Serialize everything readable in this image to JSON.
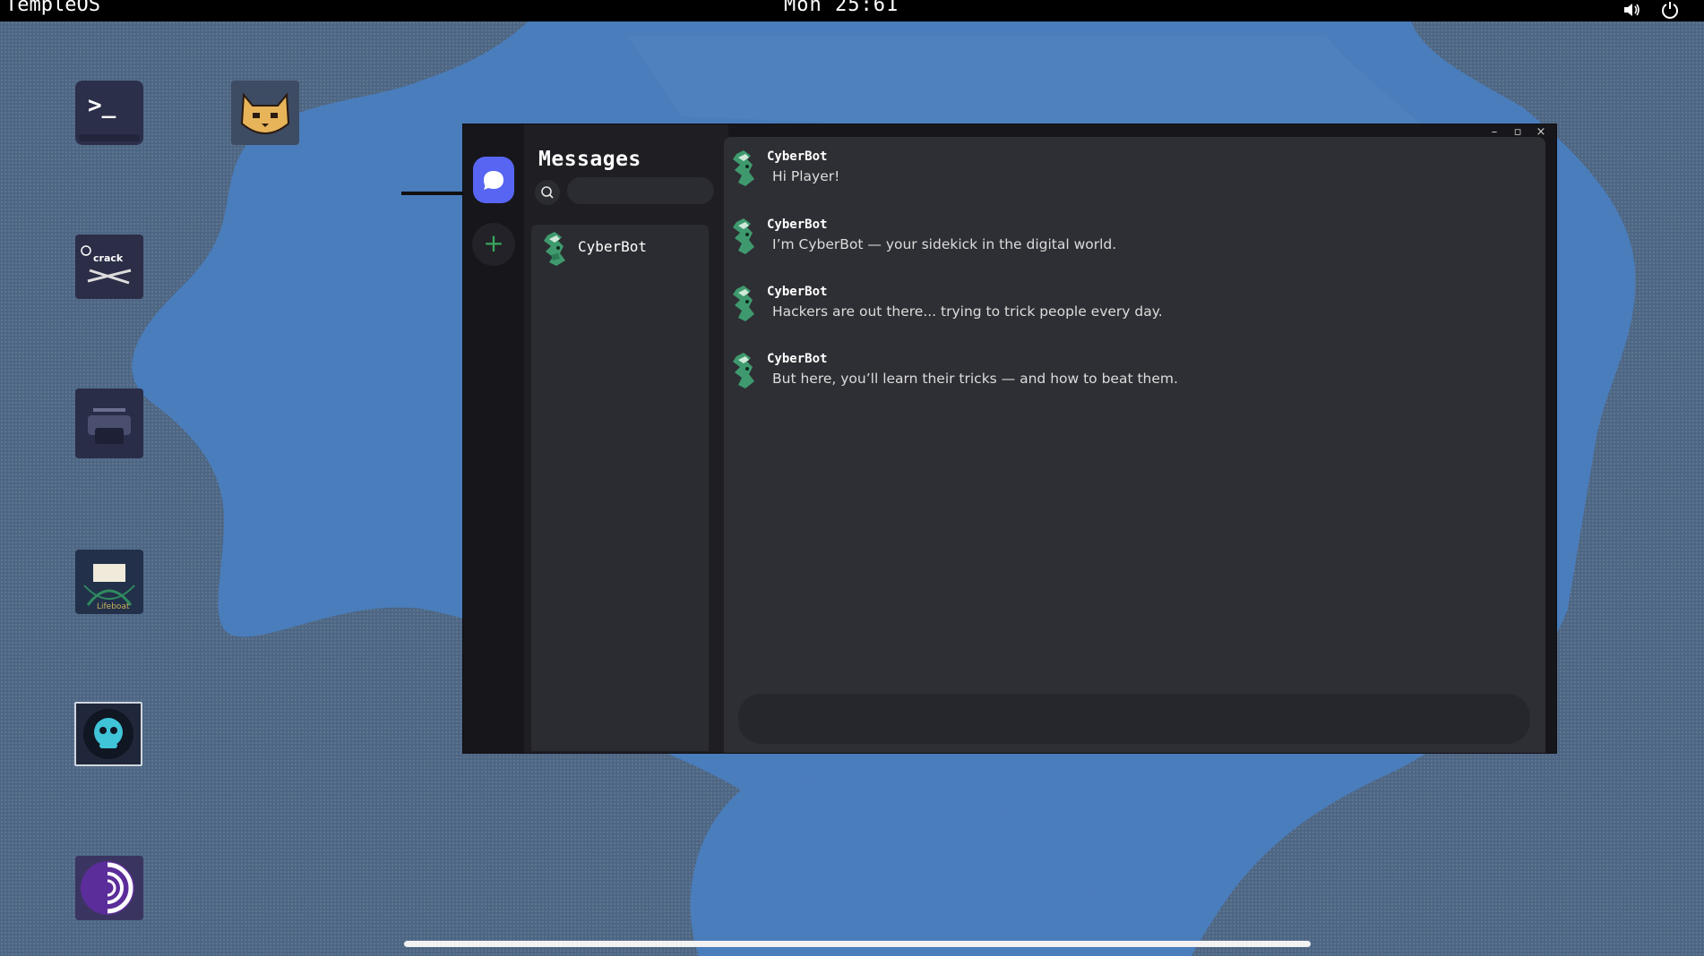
{
  "os": {
    "name": "TempleOS",
    "clock": "Mon 25:61"
  },
  "desktop": {
    "icons": [
      {
        "name": "terminal-icon",
        "glyph": ">_"
      },
      {
        "name": "cat-app-icon"
      },
      {
        "name": "crack-app-icon",
        "label": "crack"
      },
      {
        "name": "car-app-icon"
      },
      {
        "name": "lifeboat-app-icon",
        "label": "Lifeboat"
      },
      {
        "name": "chat-bot-app-icon"
      },
      {
        "name": "tor-browser-icon"
      }
    ]
  },
  "window": {
    "controls": {
      "minimize": "–",
      "maximize": "▫",
      "close": "×"
    },
    "sidebar": {
      "title": "Messages",
      "search_placeholder": "",
      "add_button": "+",
      "contacts": [
        {
          "name": "CyberBot"
        }
      ]
    },
    "chat": {
      "messages": [
        {
          "author": "CyberBot",
          "text": "Hi Player!"
        },
        {
          "author": "CyberBot",
          "text": "I’m CyberBot — your sidekick in the digital world."
        },
        {
          "author": "CyberBot",
          "text": "Hackers are out there... trying to trick people every day."
        },
        {
          "author": "CyberBot",
          "text": "But here, you’ll learn their tricks — and how to beat them."
        }
      ],
      "composer_placeholder": ""
    }
  },
  "colors": {
    "accent": "#5865f2",
    "add_green": "#3ba55d",
    "desktop_blue": "#4a7dbb",
    "desktop_slate": "#4d6684"
  }
}
